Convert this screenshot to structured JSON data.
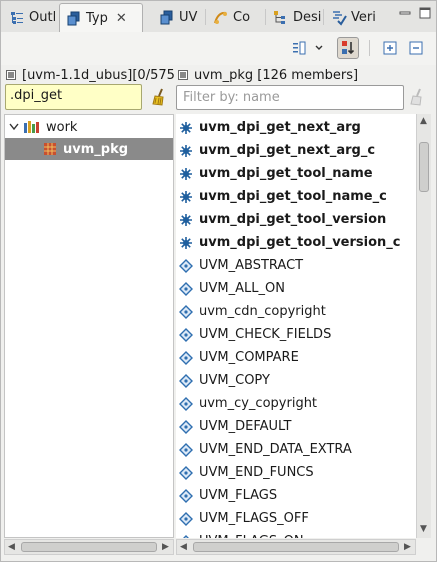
{
  "tabs": [
    {
      "label": "Outl",
      "icon": "outline-icon"
    },
    {
      "label": "Typ",
      "icon": "type-hierarchy-icon",
      "active": true,
      "close": "✕"
    },
    {
      "label": "UV",
      "icon": "uvm-icon"
    },
    {
      "label": "Co",
      "icon": "coverage-icon"
    },
    {
      "label": "Desi",
      "icon": "design-icon"
    },
    {
      "label": "Veri",
      "icon": "verification-icon"
    }
  ],
  "headers": {
    "left": "[uvm-1.1d_ubus][0/575",
    "right": "uvm_pkg [126 members]"
  },
  "filters": {
    "left_value": ".dpi_get",
    "right_placeholder": "Filter by: name"
  },
  "tree": [
    {
      "label": "work",
      "icon": "library-icon",
      "expanded": true
    },
    {
      "label": "uvm_pkg",
      "icon": "package-icon",
      "selected": true
    }
  ],
  "members": [
    {
      "label": "uvm_dpi_get_next_arg",
      "kind": "function",
      "bold": true
    },
    {
      "label": "uvm_dpi_get_next_arg_c",
      "kind": "function",
      "bold": true
    },
    {
      "label": "uvm_dpi_get_tool_name",
      "kind": "function",
      "bold": true
    },
    {
      "label": "uvm_dpi_get_tool_name_c",
      "kind": "function",
      "bold": true
    },
    {
      "label": "uvm_dpi_get_tool_version",
      "kind": "function",
      "bold": true
    },
    {
      "label": "uvm_dpi_get_tool_version_c",
      "kind": "function",
      "bold": true
    },
    {
      "label": "UVM_ABSTRACT",
      "kind": "constant"
    },
    {
      "label": "UVM_ALL_ON",
      "kind": "constant"
    },
    {
      "label": "uvm_cdn_copyright",
      "kind": "constant"
    },
    {
      "label": "UVM_CHECK_FIELDS",
      "kind": "constant"
    },
    {
      "label": "UVM_COMPARE",
      "kind": "constant"
    },
    {
      "label": "UVM_COPY",
      "kind": "constant"
    },
    {
      "label": "uvm_cy_copyright",
      "kind": "constant"
    },
    {
      "label": "UVM_DEFAULT",
      "kind": "constant"
    },
    {
      "label": "UVM_END_DATA_EXTRA",
      "kind": "constant"
    },
    {
      "label": "UVM_END_FUNCS",
      "kind": "constant"
    },
    {
      "label": "UVM_FLAGS",
      "kind": "constant"
    },
    {
      "label": "UVM_FLAGS_OFF",
      "kind": "constant"
    },
    {
      "label": "UVM_FLAGS_ON",
      "kind": "constant"
    }
  ],
  "colors": {
    "filter_highlight": "#ffffc6",
    "selection": "#8a8a8a",
    "function_icon": "#1f5f9e",
    "constant_icon": "#2f6fb0"
  }
}
